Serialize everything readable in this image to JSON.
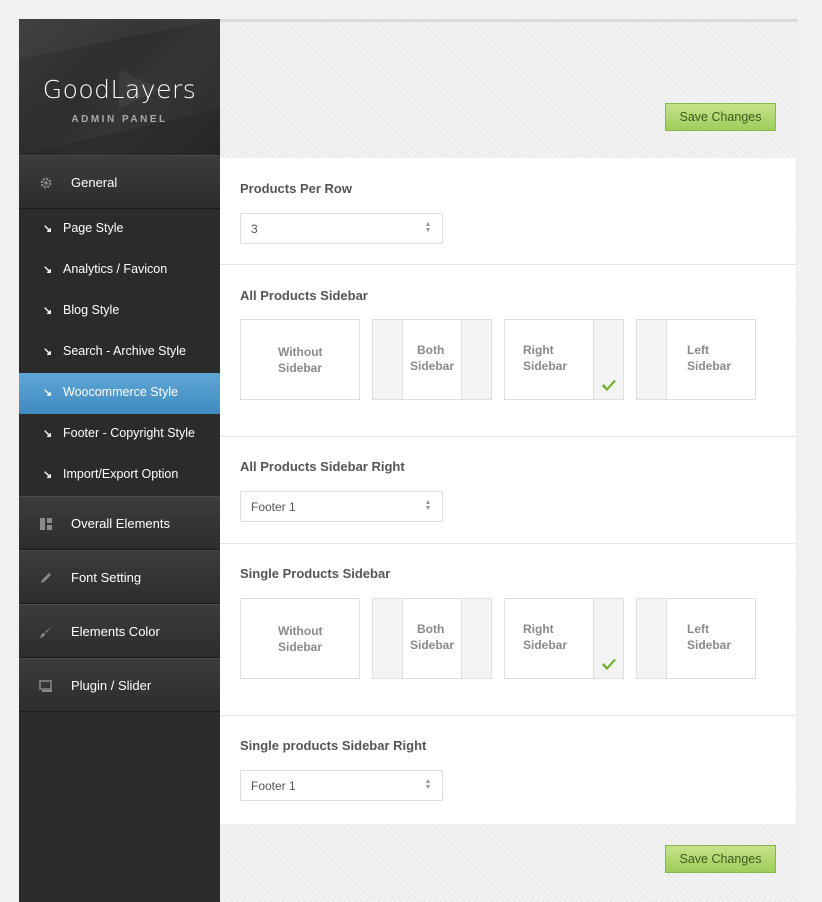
{
  "brand": {
    "name": "GoodLayers",
    "subtitle": "ADMIN PANEL"
  },
  "nav": {
    "general": {
      "label": "General",
      "icon": "gear-icon"
    },
    "sub_items": [
      {
        "label": "Page Style"
      },
      {
        "label": "Analytics / Favicon"
      },
      {
        "label": "Blog Style"
      },
      {
        "label": "Search - Archive Style"
      },
      {
        "label": "Woocommerce Style",
        "active": true
      },
      {
        "label": "Footer - Copyright Style"
      },
      {
        "label": "Import/Export Option"
      }
    ],
    "main_items": [
      {
        "label": "Overall Elements",
        "icon": "layout-icon"
      },
      {
        "label": "Font Setting",
        "icon": "pencil-icon"
      },
      {
        "label": "Elements Color",
        "icon": "brush-icon"
      },
      {
        "label": "Plugin / Slider",
        "icon": "slider-icon"
      }
    ]
  },
  "toolbar": {
    "save_label": "Save Changes"
  },
  "sections": {
    "products_per_row": {
      "title": "Products Per Row",
      "value": "3"
    },
    "all_products_sidebar": {
      "title": "All Products Sidebar",
      "options": [
        {
          "line1": "Without",
          "line2": "Sidebar"
        },
        {
          "line1": "Both",
          "line2": "Sidebar"
        },
        {
          "line1": "Right",
          "line2": "Sidebar",
          "selected": true
        },
        {
          "line1": "Left",
          "line2": "Sidebar"
        }
      ]
    },
    "all_products_sidebar_right": {
      "title": "All Products Sidebar Right",
      "value": "Footer 1"
    },
    "single_products_sidebar": {
      "title": "Single Products Sidebar",
      "options": [
        {
          "line1": "Without",
          "line2": "Sidebar"
        },
        {
          "line1": "Both",
          "line2": "Sidebar"
        },
        {
          "line1": "Right",
          "line2": "Sidebar",
          "selected": true
        },
        {
          "line1": "Left",
          "line2": "Sidebar"
        }
      ]
    },
    "single_products_sidebar_right": {
      "title": "Single products Sidebar Right",
      "value": "Footer 1"
    }
  },
  "colors": {
    "accent": "#4a95c9",
    "save_button": "#b3d875",
    "sidebar_bg": "#2b2b2b",
    "check": "#6fae2b"
  }
}
